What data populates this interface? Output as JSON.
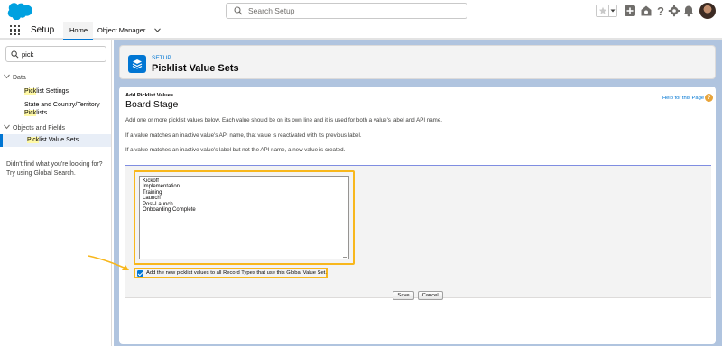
{
  "topbar": {
    "search_placeholder": "Search Setup"
  },
  "navbar": {
    "app_name": "Setup",
    "tabs": [
      {
        "label": "Home"
      },
      {
        "label": "Object Manager"
      }
    ]
  },
  "sidebar": {
    "quick_find_value": "pick",
    "sections": [
      {
        "label": "Data",
        "items": [
          {
            "hl": "Pick",
            "rest": "list Settings"
          },
          {
            "line1": "State and Country/Territory",
            "hl": "Pick",
            "rest": "lists"
          }
        ]
      },
      {
        "label": "Objects and Fields",
        "items": [
          {
            "hl": "Pick",
            "rest": "list Value Sets"
          }
        ]
      }
    ],
    "help_text": "Didn't find what you're looking for? Try using Global Search."
  },
  "header": {
    "eyebrow": "SETUP",
    "title": "Picklist Value Sets"
  },
  "main": {
    "subtitle": "Add Picklist Values",
    "title": "Board Stage",
    "help_link": "Help for this Page",
    "paragraphs": [
      "Add one or more picklist values below. Each value should be on its own line and it is used for both a value's label and API name.",
      "If a value matches an inactive value's API name, that value is reactivated with its previous label.",
      "If a value matches an inactive value's label but not the API name, a new value is created."
    ],
    "values": [
      "Kickoff",
      "Implementation",
      "Training",
      "Launch",
      "Post-Launch",
      "Onboarding Complete"
    ],
    "checkbox_label": "Add the new picklist values to all Record Types that use this Global Value Set.",
    "checkbox_checked": true,
    "save_label": "Save",
    "cancel_label": "Cancel"
  },
  "colors": {
    "brand": "#0176d3",
    "highlight": "#f8b71c",
    "background": "#b0c4df"
  }
}
